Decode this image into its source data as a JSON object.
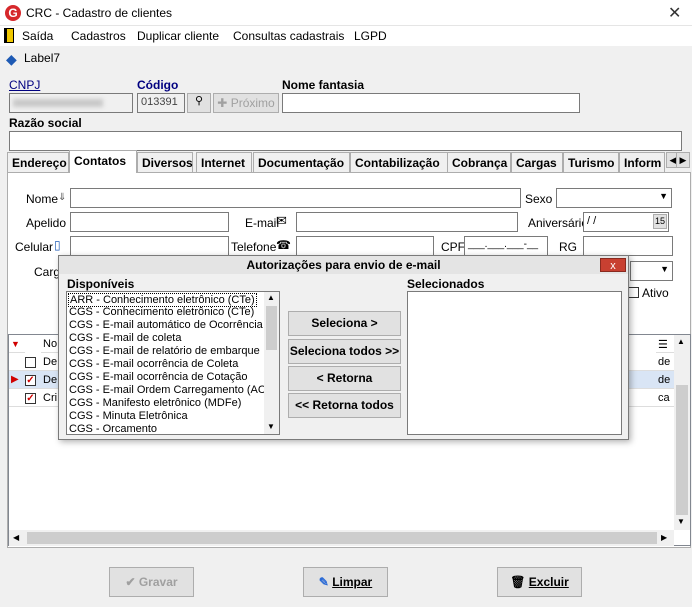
{
  "window": {
    "title": "CRC - Cadastro de clientes",
    "close": "✕",
    "icon_letter": "G"
  },
  "menu": [
    "Saída",
    "Cadastros",
    "Duplicar cliente",
    "Consultas cadastrais",
    "LGPD"
  ],
  "label7": "Label7",
  "header": {
    "cnpj_label": "CNPJ",
    "codigo_label": "Código",
    "nome_fantasia_label": "Nome fantasia",
    "codigo_value": "013391",
    "proximo_label": "Próximo",
    "razao_social_label": "Razão social"
  },
  "tabs": [
    "Endereço",
    "Contatos",
    "Diversos",
    "Internet",
    "Documentação",
    "Contabilização",
    "Cobrança",
    "Cargas",
    "Turismo",
    "Inform"
  ],
  "contatos": {
    "nome": "Nome",
    "sexo": "Sexo",
    "apelido": "Apelido",
    "email": "E-mail",
    "aniversario": "Aniversário",
    "aniversario_value": "/ /",
    "celular": "Celular",
    "telefone": "Telefone",
    "cpf": "CPF",
    "cpf_mask": "___.___.___-__",
    "rg": "RG",
    "cargo": "Carg",
    "ativo": "Ativo",
    "cal_day": "15"
  },
  "grid": {
    "col_no": "No",
    "rows": [
      "De",
      "De",
      "Cri"
    ],
    "right": [
      "de",
      "de",
      "ca"
    ]
  },
  "modal": {
    "title": "Autorizações para envio de e-mail",
    "close": "x",
    "disponiveis": "Disponíveis",
    "selecionados": "Selecionados",
    "items": [
      "ARR - Conhecimento eletrônico (CTe)",
      "CGS - Conhecimento eletrônico (CTe)",
      "CGS - E-mail automático de Ocorrência",
      "CGS - E-mail de coleta",
      "CGS - E-mail de relatório de embarque",
      "CGS - E-mail ocorrência de Coleta",
      "CGS - E-mail ocorrência de Cotação",
      "CGS - E-mail Ordem Carregamento (ACT)",
      "CGS - Manifesto eletrônico (MDFe)",
      "CGS - Minuta Eletrônica",
      "CGS - Orcamento"
    ],
    "btn_seleciona": "Seleciona >",
    "btn_seleciona_todos": "Seleciona todos >>",
    "btn_retorna": "< Retorna",
    "btn_retorna_todos": "<< Retorna todos"
  },
  "footer": {
    "gravar": "Gravar",
    "limpar": "Limpar",
    "excluir": "Excluir"
  },
  "colors": {
    "accent": "#d6282b",
    "selected_row": "#d9e5f5",
    "link": "#000080"
  }
}
